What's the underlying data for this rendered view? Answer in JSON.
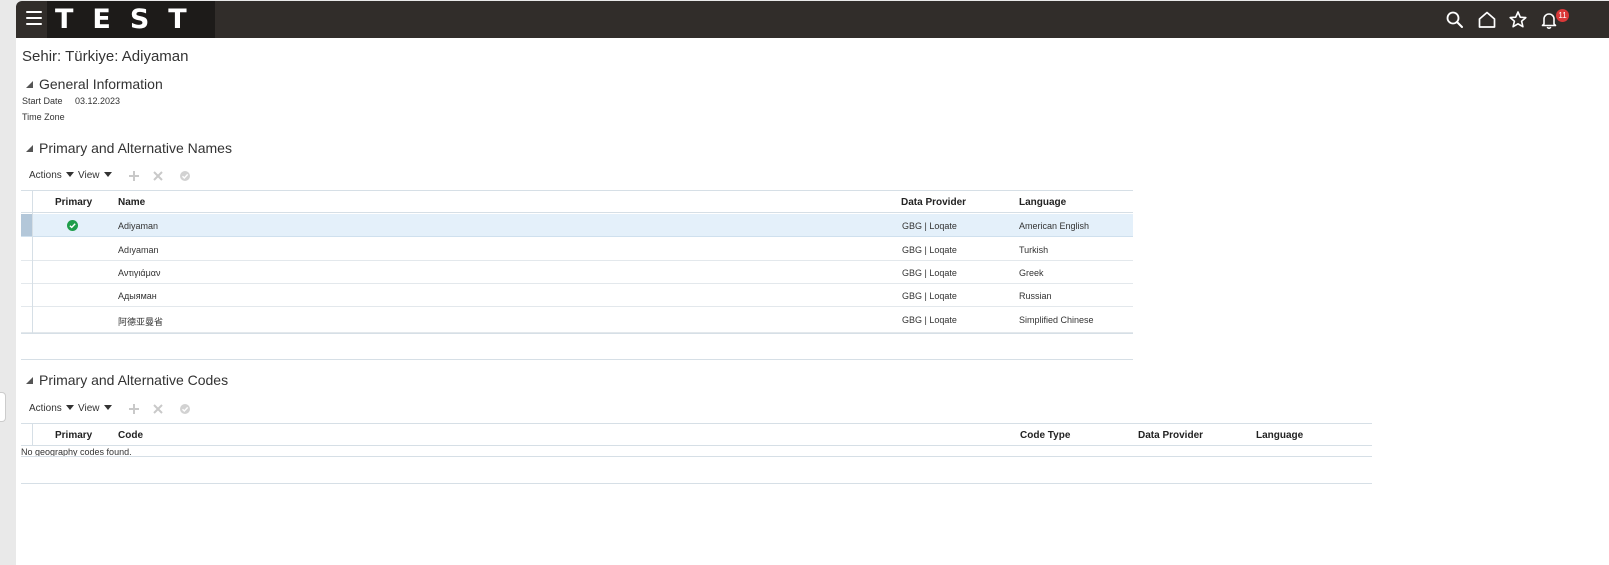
{
  "app": {
    "logo_text": "TEST",
    "notification_count": "11"
  },
  "page": {
    "title": "Sehir: Türkiye: Adiyaman"
  },
  "general": {
    "heading": "General Information",
    "start_date_label": "Start Date",
    "start_date_value": "03.12.2023",
    "time_zone_label": "Time Zone"
  },
  "names": {
    "heading": "Primary and Alternative Names",
    "toolbar": {
      "actions": "Actions",
      "view": "View"
    },
    "columns": {
      "primary": "Primary",
      "name": "Name",
      "provider": "Data Provider",
      "language": "Language"
    },
    "rows": [
      {
        "primary": true,
        "name": "Adiyaman",
        "provider": "GBG | Loqate",
        "language": "American English"
      },
      {
        "primary": false,
        "name": "Adıyaman",
        "provider": "GBG | Loqate",
        "language": "Turkish"
      },
      {
        "primary": false,
        "name": "Αντιγιάμαν",
        "provider": "GBG | Loqate",
        "language": "Greek"
      },
      {
        "primary": false,
        "name": "Адыяман",
        "provider": "GBG | Loqate",
        "language": "Russian"
      },
      {
        "primary": false,
        "name": "阿德亚曼省",
        "provider": "GBG | Loqate",
        "language": "Simplified Chinese"
      }
    ]
  },
  "codes": {
    "heading": "Primary and Alternative Codes",
    "toolbar": {
      "actions": "Actions",
      "view": "View"
    },
    "columns": {
      "primary": "Primary",
      "code": "Code",
      "code_type": "Code Type",
      "provider": "Data Provider",
      "language": "Language"
    },
    "empty_message": "No geography codes found."
  },
  "colors": {
    "header_bg": "#312d2a",
    "selected_row": "#e4f0fa",
    "check_green": "#1f9e4a"
  }
}
